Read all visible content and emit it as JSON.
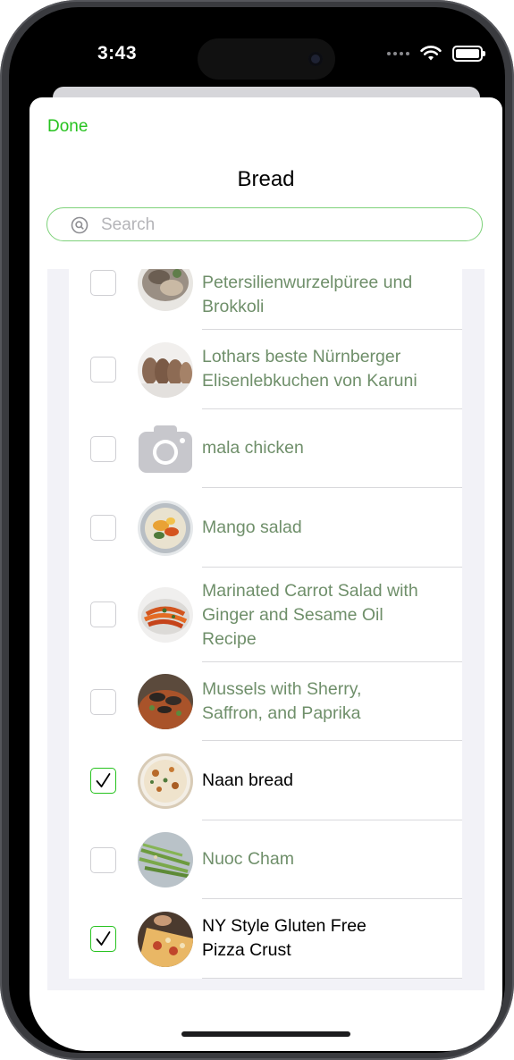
{
  "status_bar": {
    "time": "3:43"
  },
  "sheet": {
    "done_label": "Done",
    "title": "Bread",
    "search": {
      "placeholder": "Search",
      "value": ""
    }
  },
  "colors": {
    "accent": "#26c21e",
    "unselected_text": "#6f8f6a",
    "list_background": "#f2f2f7"
  },
  "recipes": [
    {
      "line1": "Petersilienwurzelpüree und",
      "line2": "Brokkoli",
      "line3": "",
      "checked": false,
      "thumb_icon": "food-photo"
    },
    {
      "line1": "Lothars beste Nürnberger",
      "line2": "Elisenlebkuchen von Karuni",
      "line3": "",
      "checked": false,
      "thumb_icon": "food-photo"
    },
    {
      "line1": "mala chicken",
      "line2": "",
      "line3": "",
      "checked": false,
      "thumb_icon": "camera-placeholder"
    },
    {
      "line1": "Mango salad",
      "line2": "",
      "line3": "",
      "checked": false,
      "thumb_icon": "food-photo"
    },
    {
      "line1": "Marinated Carrot Salad with",
      "line2": "Ginger and Sesame Oil",
      "line3": "Recipe",
      "checked": false,
      "thumb_icon": "food-photo"
    },
    {
      "line1": "Mussels with Sherry,",
      "line2": "Saffron, and Paprika",
      "line3": "",
      "checked": false,
      "thumb_icon": "food-photo"
    },
    {
      "line1": "Naan bread",
      "line2": "",
      "line3": "",
      "checked": true,
      "thumb_icon": "food-photo"
    },
    {
      "line1": "Nuoc Cham",
      "line2": "",
      "line3": "",
      "checked": false,
      "thumb_icon": "food-photo"
    },
    {
      "line1": "NY Style Gluten Free",
      "line2": "Pizza Crust",
      "line3": "",
      "checked": true,
      "thumb_icon": "food-photo"
    }
  ]
}
